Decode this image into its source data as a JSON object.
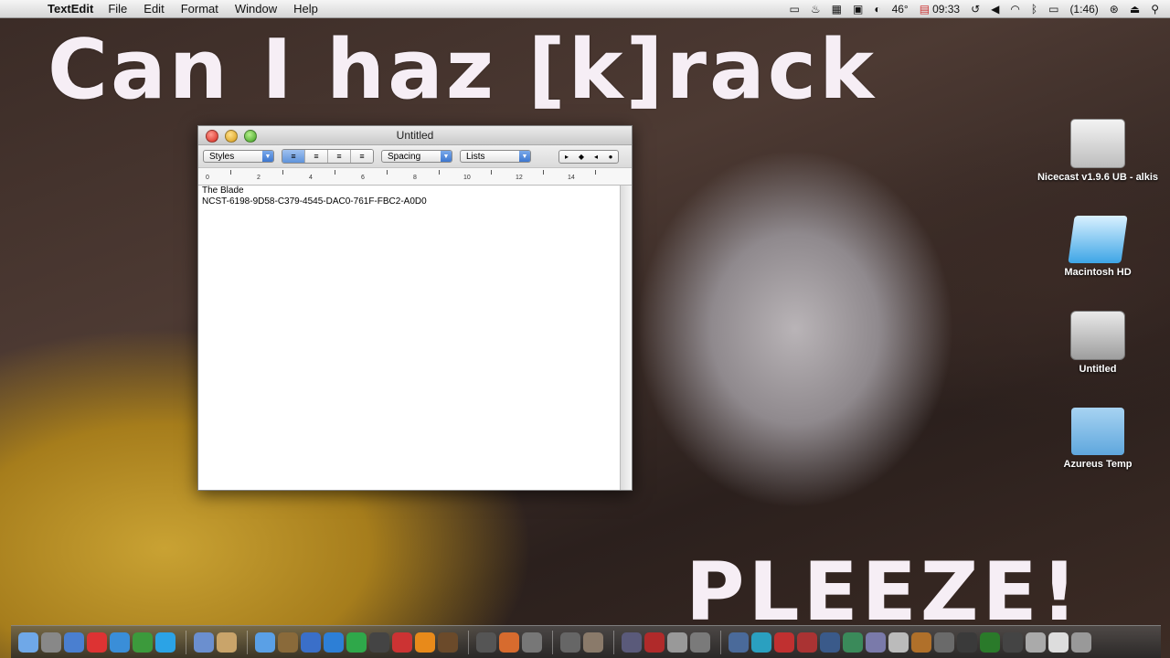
{
  "menubar": {
    "apple": "",
    "app_name": "TextEdit",
    "items": [
      "File",
      "Edit",
      "Format",
      "Window",
      "Help"
    ],
    "status": {
      "temperature": "46°",
      "clock": "09:33",
      "battery": "(1:46)"
    }
  },
  "desktop": {
    "caption_top": "Can I haz [k]rack",
    "caption_bottom": "PLEEZE!",
    "icons": [
      {
        "label": "Nicecast v1.9.6 UB - alkis",
        "icon": "disk-image-icon"
      },
      {
        "label": "Macintosh HD",
        "icon": "laptop-icon"
      },
      {
        "label": "Untitled",
        "icon": "hard-drive-icon"
      },
      {
        "label": "Azureus Temp",
        "icon": "folder-icon"
      }
    ]
  },
  "window": {
    "title": "Untitled",
    "toolbar": {
      "styles": "Styles",
      "spacing": "Spacing",
      "lists": "Lists"
    },
    "ruler_labels": [
      "0",
      "2",
      "4",
      "6",
      "8",
      "10",
      "12",
      "14"
    ],
    "document": {
      "line1": "The Blade",
      "line2": "NCST-6198-9D58-C379-4545-DAC0-761F-FBC2-A0D0"
    }
  },
  "colors": {
    "caption": "#f6eef5",
    "accent_blue": "#5f93db"
  }
}
